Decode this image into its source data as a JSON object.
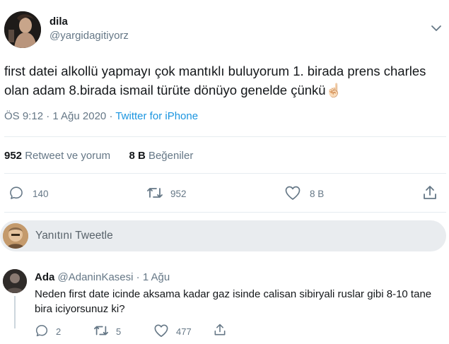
{
  "tweet": {
    "author_name": "dila",
    "author_handle": "@yargidagitiyorz",
    "text": "first datei alkollü yapmayı çok mantıklı buluyorum 1. birada prens charles olan adam 8.birada ismail türüte dönüyo genelde çünkü",
    "emoji": "☝🏻",
    "time": "ÖS 9:12 · 1 Ağu 2020 · ",
    "source": "Twitter for iPhone",
    "retweet_count": "952",
    "retweet_label": "Retweet ve yorum",
    "like_count": "8 B",
    "like_label": "Beğeniler",
    "actions": {
      "reply_count": "140",
      "retweet_count": "952",
      "like_count": "8 B"
    }
  },
  "reply_box": {
    "placeholder": "Yanıtını Tweetle"
  },
  "reply": {
    "author_name": "Ada",
    "author_handle": "@AdaninKasesi",
    "time": "· 1 Ağu",
    "text": "Neden first date icinde aksama kadar gaz isinde calisan sibiryali ruslar gibi 8-10 tane bira iciyorsunuz ki?",
    "actions": {
      "reply_count": "2",
      "retweet_count": "5",
      "like_count": "477"
    }
  },
  "colors": {
    "link": "#1b95e0",
    "muted": "#657786",
    "text": "#14171a",
    "reply_bar": "#e9ecef"
  }
}
